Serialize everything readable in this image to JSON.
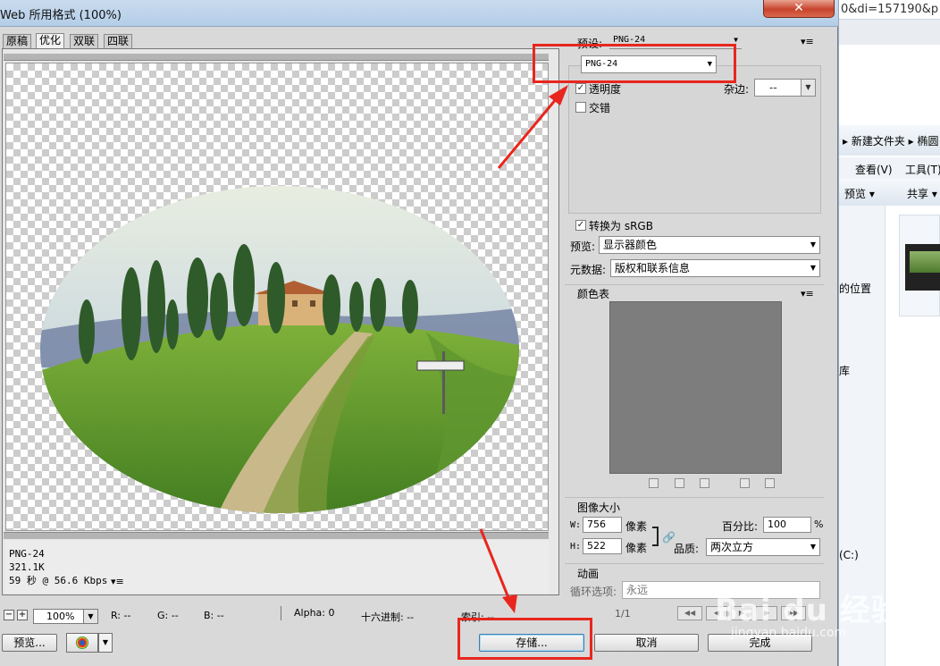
{
  "window": {
    "title": "Web 所用格式 (100%)",
    "close": "✕"
  },
  "tabs": [
    {
      "label": "原稿",
      "active": false
    },
    {
      "label": "优化",
      "active": true
    },
    {
      "label": "双联",
      "active": false
    },
    {
      "label": "四联",
      "active": false
    }
  ],
  "image_info": {
    "format": "PNG-24",
    "size": "321.1K",
    "time": "59 秒 @ 56.6 Kbps",
    "menu_icon": "▾≡"
  },
  "status_bar": {
    "zoom_out": "−",
    "zoom_in": "+",
    "zoom": "100%",
    "r": "R: --",
    "g": "G: --",
    "b": "B: --",
    "alpha": "Alpha: 0",
    "hex": "十六进制: --",
    "index": "索引: --"
  },
  "buttons": {
    "preview": "预览...",
    "save": "存储...",
    "cancel": "取消",
    "done": "完成"
  },
  "settings": {
    "preset_label": "预设:",
    "preset_value": "PNG-24",
    "format_value": "PNG-24",
    "transparency_label": "透明度",
    "transparency_checked": true,
    "matte_label": "杂边:",
    "matte_value": "--",
    "interlaced_label": "交错",
    "interlaced_checked": false,
    "convert_srgb_label": "转换为 sRGB",
    "convert_srgb_checked": true,
    "preview_label": "预览:",
    "preview_value": "显示器颜色",
    "metadata_label": "元数据:",
    "metadata_value": "版权和联系信息",
    "color_table_label": "颜色表",
    "image_size_label": "图像大小",
    "w_label": "W:",
    "w_value": "756",
    "h_label": "H:",
    "h_value": "522",
    "px_unit": "像素",
    "percent_label": "百分比:",
    "percent_value": "100",
    "percent_unit": "%",
    "quality_label": "品质:",
    "quality_value": "两次立方",
    "animation_label": "动画",
    "loop_label": "循环选项:",
    "loop_value": "永远",
    "frame_counter": "1/1"
  },
  "background_window": {
    "address": "0&di=157190&p",
    "breadcrumb": "▸ 新建文件夹 ▸ 椭圆",
    "menu_view": "查看(V)",
    "menu_tools": "工具(T)",
    "tool_preview": "预览 ▾",
    "tool_share": "共享 ▾",
    "nav_location": "的位置",
    "nav_library": "库",
    "nav_drive": "(C:)"
  },
  "watermark": {
    "text": "Bai du 经验",
    "url": "jingyan.baidu.com"
  },
  "accent_red": "#e8261e"
}
